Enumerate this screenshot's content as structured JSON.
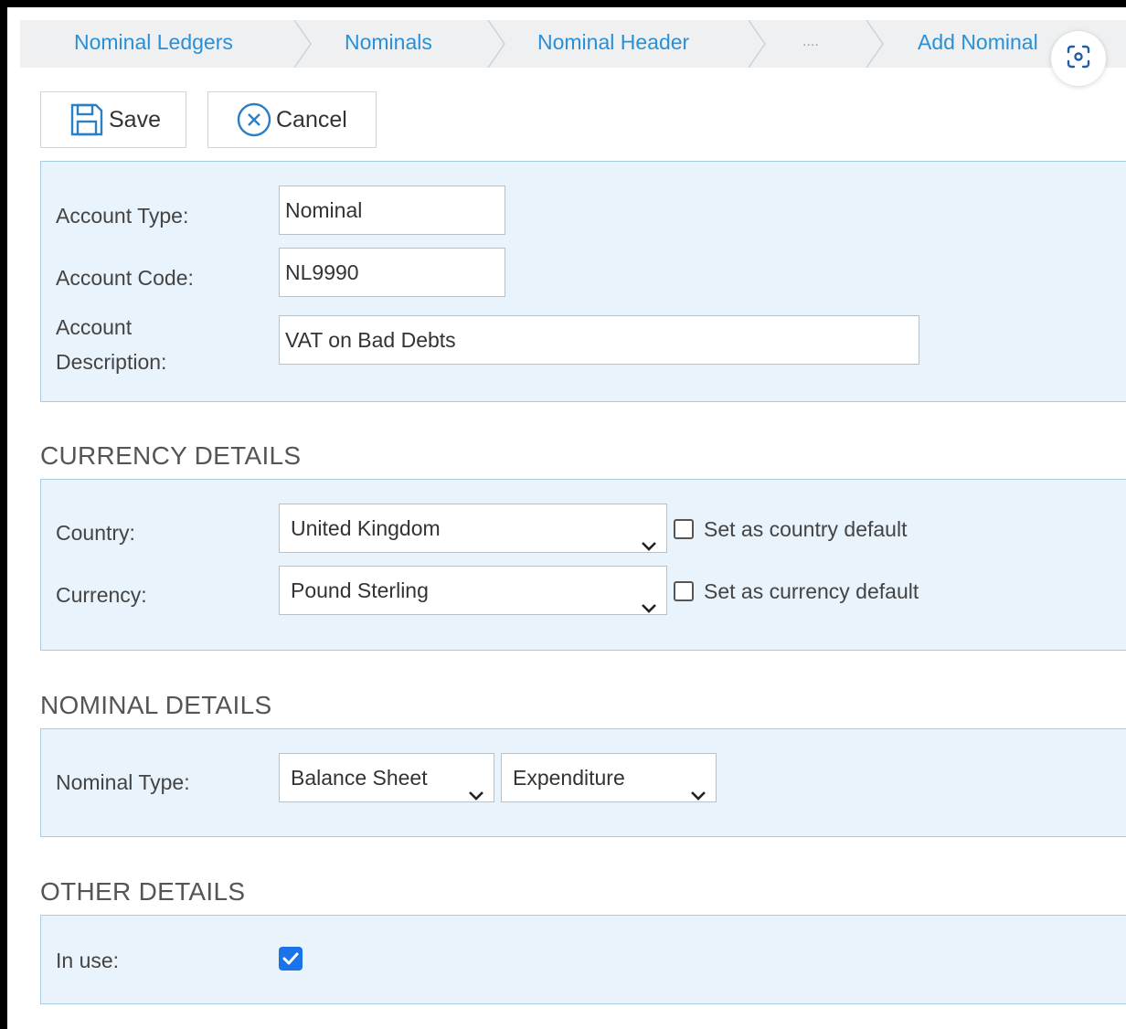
{
  "breadcrumb": {
    "items": [
      {
        "label": "Nominal Ledgers"
      },
      {
        "label": "Nominals"
      },
      {
        "label": "Nominal Header"
      },
      {
        "label": "...."
      },
      {
        "label": "Add Nominal"
      }
    ]
  },
  "toolbar": {
    "save_label": "Save",
    "cancel_label": "Cancel"
  },
  "account": {
    "type_label": "Account Type:",
    "type_value": "Nominal",
    "code_label": "Account Code:",
    "code_value": "NL9990",
    "description_label_line1": "Account",
    "description_label_line2": "Description:",
    "description_value": "VAT on Bad Debts"
  },
  "currency_details": {
    "title": "CURRENCY DETAILS",
    "country_label": "Country:",
    "country_value": "United Kingdom",
    "country_default_label": "Set as country default",
    "country_default_checked": false,
    "currency_label": "Currency:",
    "currency_value": "Pound Sterling",
    "currency_default_label": "Set as currency default",
    "currency_default_checked": false
  },
  "nominal_details": {
    "title": "NOMINAL DETAILS",
    "type_label": "Nominal Type:",
    "type_value_1": "Balance Sheet",
    "type_value_2": "Expenditure"
  },
  "other_details": {
    "title": "OTHER DETAILS",
    "in_use_label": "In use:",
    "in_use_checked": true
  },
  "colors": {
    "link": "#2b8fd6",
    "panel_bg": "#e9f3fb",
    "panel_border": "#a9cbe4",
    "checkbox_checked": "#1a73e8"
  },
  "icons": [
    "save-icon",
    "cancel-circle-x-icon",
    "chevron-down-icon",
    "screen-capture-icon",
    "checkmark-icon"
  ]
}
